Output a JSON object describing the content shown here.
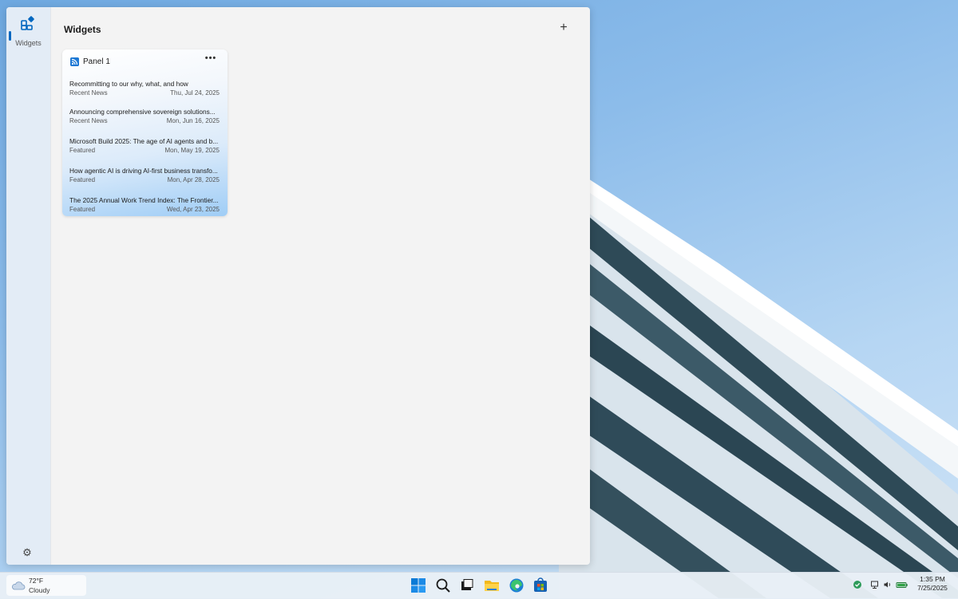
{
  "rail": {
    "widgets_label": "Widgets"
  },
  "board": {
    "title": "Widgets",
    "add_symbol": "+"
  },
  "card": {
    "title": "Panel 1",
    "more_symbol": "•••",
    "items": [
      {
        "title": "Recommitting to our why, what, and how",
        "category": "Recent News",
        "date": "Thu, Jul 24, 2025"
      },
      {
        "title": "Announcing comprehensive sovereign solutions...",
        "category": "Recent News",
        "date": "Mon, Jun 16, 2025"
      },
      {
        "title": "Microsoft Build 2025: The age of AI agents and b...",
        "category": "Featured",
        "date": "Mon, May 19, 2025"
      },
      {
        "title": "How agentic AI is driving AI-first business transfo...",
        "category": "Featured",
        "date": "Mon, Apr 28, 2025"
      },
      {
        "title": "The 2025 Annual Work Trend Index: The Frontier...",
        "category": "Featured",
        "date": "Wed, Apr 23, 2025"
      }
    ]
  },
  "taskbar": {
    "weather": {
      "temp": "72°F",
      "condition": "Cloudy"
    },
    "apps": [
      "start-icon",
      "search-icon",
      "task-view-icon",
      "file-explorer-icon",
      "edge-icon",
      "store-icon"
    ],
    "clock": {
      "time": "1:35 PM",
      "date": "7/25/2025"
    }
  },
  "colors": {
    "accent": "#0067c0",
    "card_gradient_end": "#9fcdf6"
  }
}
